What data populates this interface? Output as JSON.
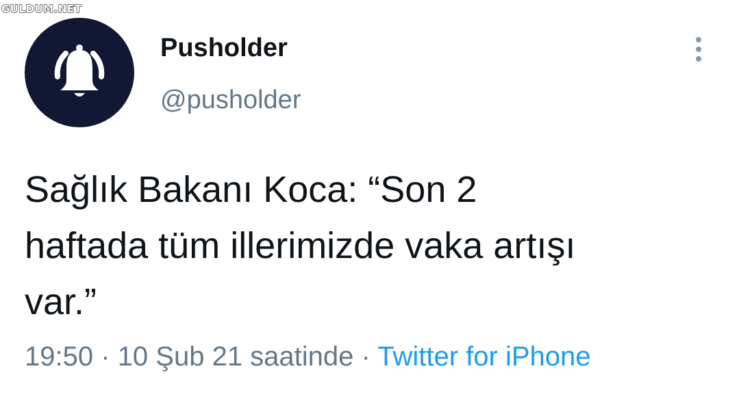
{
  "watermark": "GULDUM.NET",
  "account": {
    "display_name": "Pusholder",
    "handle": "@pusholder",
    "avatar_icon": "bell-icon"
  },
  "menu": {
    "icon": "more-vertical-icon"
  },
  "tweet": {
    "text": "Sağlık Bakanı Koca: “Son 2\nhaftada tüm illerimizde vaka artışı\nvar.”",
    "time": "19:50",
    "separator": "·",
    "date_text": "10 Şub 21 saatinde",
    "source": "Twitter for iPhone"
  },
  "colors": {
    "avatar_bg": "#121733",
    "text_primary": "#0f1419",
    "text_secondary": "#657786",
    "link": "#1d9bf0"
  }
}
